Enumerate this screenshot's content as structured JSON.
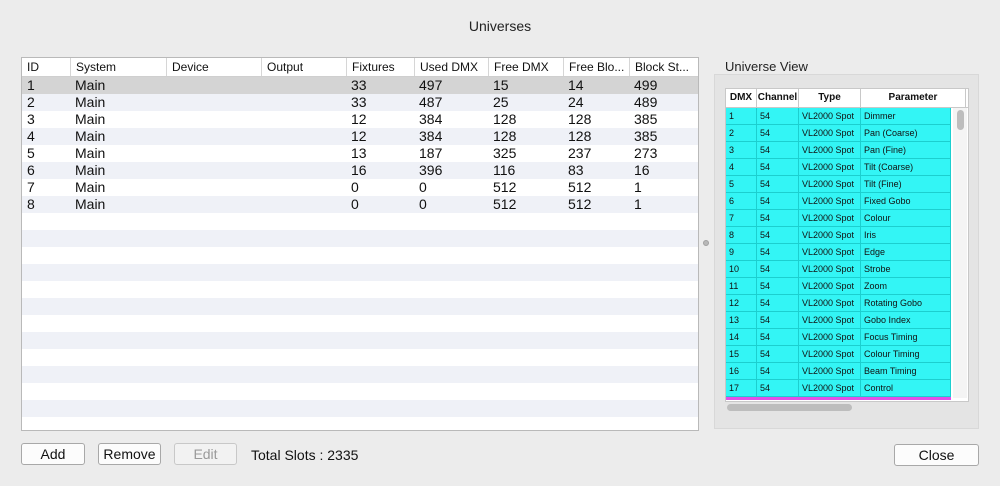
{
  "window": {
    "title": "Universes"
  },
  "universes_table": {
    "columns": [
      "ID",
      "System",
      "Device",
      "Output",
      "Fixtures",
      "Used DMX",
      "Free DMX",
      "Free Blo...",
      "Block St..."
    ],
    "rows": [
      [
        "1",
        "Main",
        "",
        "",
        "33",
        "497",
        "15",
        "14",
        "499"
      ],
      [
        "2",
        "Main",
        "",
        "",
        "33",
        "487",
        "25",
        "24",
        "489"
      ],
      [
        "3",
        "Main",
        "",
        "",
        "12",
        "384",
        "128",
        "128",
        "385"
      ],
      [
        "4",
        "Main",
        "",
        "",
        "12",
        "384",
        "128",
        "128",
        "385"
      ],
      [
        "5",
        "Main",
        "",
        "",
        "13",
        "187",
        "325",
        "237",
        "273"
      ],
      [
        "6",
        "Main",
        "",
        "",
        "16",
        "396",
        "116",
        "83",
        "16"
      ],
      [
        "7",
        "Main",
        "",
        "",
        "0",
        "0",
        "512",
        "512",
        "1"
      ],
      [
        "8",
        "Main",
        "",
        "",
        "0",
        "0",
        "512",
        "512",
        "1"
      ]
    ],
    "selected_row": 0
  },
  "universe_view": {
    "label": "Universe View",
    "columns": [
      "DMX",
      "Channel",
      "Type",
      "Parameter"
    ],
    "rows": [
      [
        "1",
        "54",
        "VL2000 Spot",
        "Dimmer"
      ],
      [
        "2",
        "54",
        "VL2000 Spot",
        "Pan (Coarse)"
      ],
      [
        "3",
        "54",
        "VL2000 Spot",
        "Pan (Fine)"
      ],
      [
        "4",
        "54",
        "VL2000 Spot",
        "Tilt (Coarse)"
      ],
      [
        "5",
        "54",
        "VL2000 Spot",
        "Tilt (Fine)"
      ],
      [
        "6",
        "54",
        "VL2000 Spot",
        "Fixed Gobo"
      ],
      [
        "7",
        "54",
        "VL2000 Spot",
        "Colour"
      ],
      [
        "8",
        "54",
        "VL2000 Spot",
        "Iris"
      ],
      [
        "9",
        "54",
        "VL2000 Spot",
        "Edge"
      ],
      [
        "10",
        "54",
        "VL2000 Spot",
        "Strobe"
      ],
      [
        "11",
        "54",
        "VL2000 Spot",
        "Zoom"
      ],
      [
        "12",
        "54",
        "VL2000 Spot",
        "Rotating Gobo"
      ],
      [
        "13",
        "54",
        "VL2000 Spot",
        "Gobo Index"
      ],
      [
        "14",
        "54",
        "VL2000 Spot",
        "Focus Timing"
      ],
      [
        "15",
        "54",
        "VL2000 Spot",
        "Colour Timing"
      ],
      [
        "16",
        "54",
        "VL2000 Spot",
        "Beam Timing"
      ],
      [
        "17",
        "54",
        "VL2000 Spot",
        "Control"
      ]
    ],
    "row_color": "#33f5f5",
    "highlight_color": "#e050e8"
  },
  "buttons": {
    "add": "Add",
    "remove": "Remove",
    "edit": "Edit",
    "close": "Close"
  },
  "footer": {
    "total_slots": "Total Slots : 2335"
  }
}
